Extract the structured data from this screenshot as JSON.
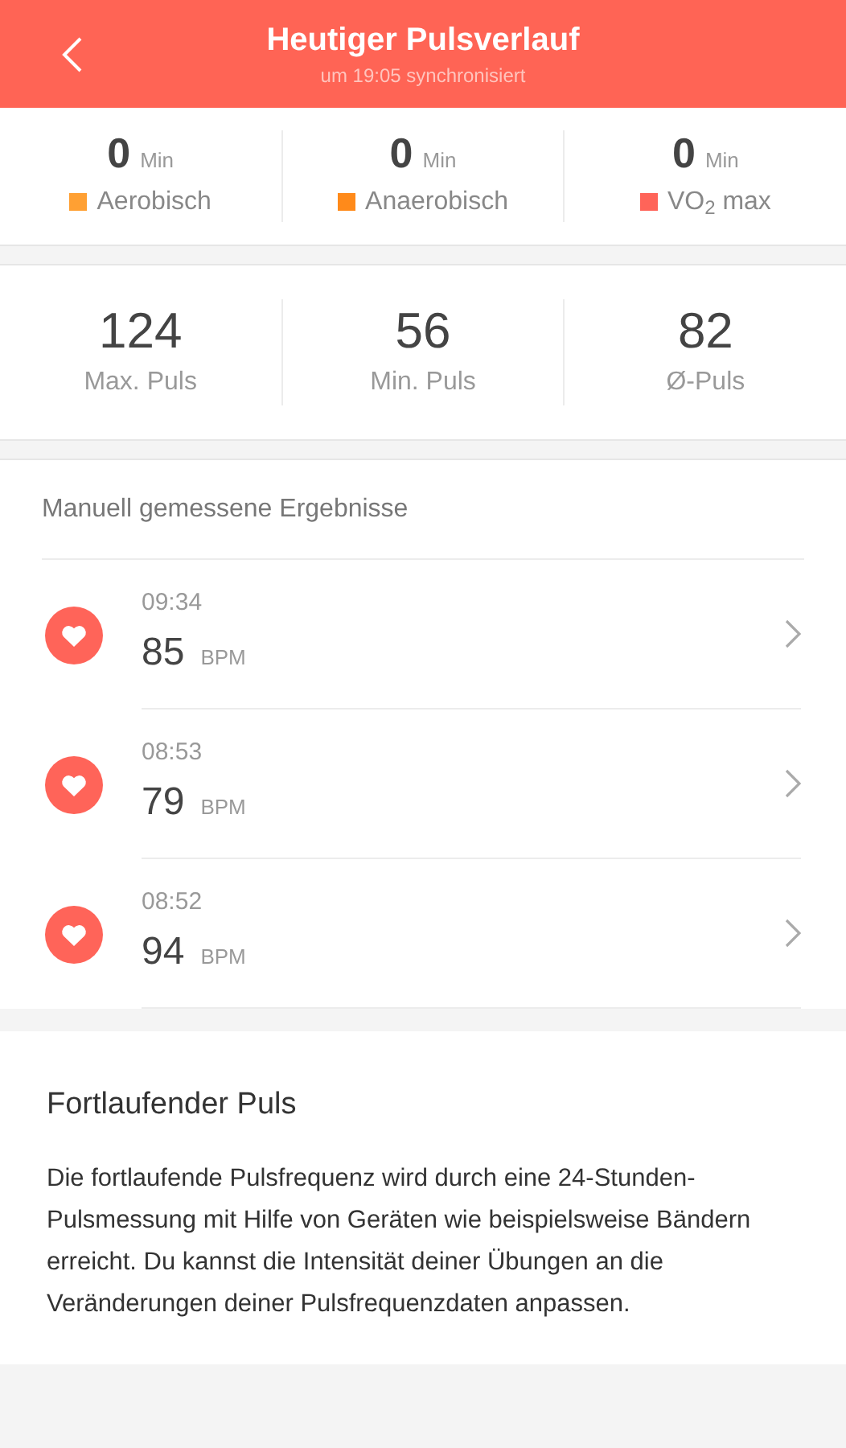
{
  "header": {
    "title": "Heutiger Pulsverlauf",
    "subtitle": "um 19:05 synchronisiert"
  },
  "zones": [
    {
      "value": "0",
      "unit": "Min",
      "label": "Aerobisch",
      "color": "#ffa033"
    },
    {
      "value": "0",
      "unit": "Min",
      "label": "Anaerobisch",
      "color": "#ff8a1a"
    },
    {
      "value": "0",
      "unit": "Min",
      "label": "VO$_{2}$ max",
      "color": "#ff6459"
    }
  ],
  "stats": [
    {
      "value": "124",
      "label": "Max. Puls"
    },
    {
      "value": "56",
      "label": "Min. Puls"
    },
    {
      "value": "82",
      "label": "Ø-Puls"
    }
  ],
  "results": {
    "title": "Manuell gemessene Ergebnisse",
    "items": [
      {
        "time": "09:34",
        "value": "85",
        "unit": "BPM"
      },
      {
        "time": "08:53",
        "value": "79",
        "unit": "BPM"
      },
      {
        "time": "08:52",
        "value": "94",
        "unit": "BPM"
      }
    ]
  },
  "info": {
    "title": "Fortlaufender Puls",
    "text": "Die fortlaufende Pulsfrequenz wird durch eine 24-Stunden-Pulsmessung mit Hilfe von Geräten wie beispielsweise Bändern erreicht. Du kannst die Intensität deiner Übungen an die Veränderungen deiner Pulsfrequenzdaten anpassen."
  }
}
